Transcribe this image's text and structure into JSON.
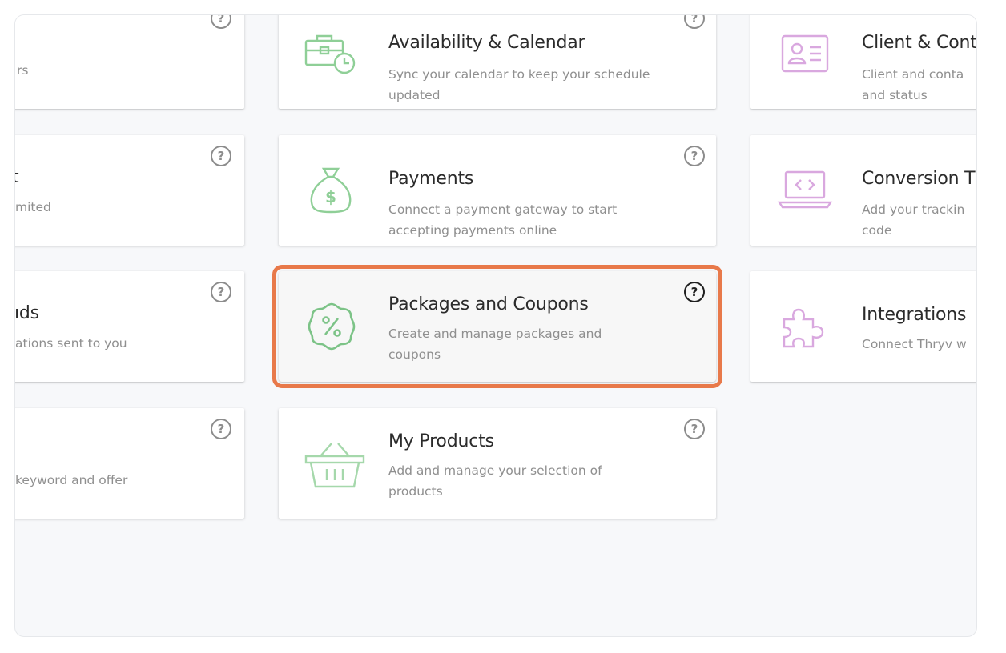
{
  "help_glyph": "?",
  "cards": {
    "left_row1": {
      "desc": "rs"
    },
    "left_row2": {
      "title": "t",
      "desc": "mited"
    },
    "left_row3": {
      "title": "ıds",
      "desc": "ations sent to you"
    },
    "left_row4": {
      "desc": "keyword and offer"
    },
    "availability": {
      "title": "Availability & Calendar",
      "desc": "Sync your calendar to keep your schedule updated",
      "icon": "briefcase-clock-icon"
    },
    "payments": {
      "title": "Payments",
      "desc": "Connect a payment gateway to start accepting payments online",
      "icon": "money-bag-icon"
    },
    "packages": {
      "title": "Packages and Coupons",
      "desc": "Create and manage packages and coupons",
      "icon": "percent-badge-icon"
    },
    "products": {
      "title": "My Products",
      "desc": "Add and manage your selection of products",
      "icon": "basket-icon"
    },
    "client": {
      "title": "Client & Cont",
      "desc": "Client and conta and status",
      "icon": "id-card-icon"
    },
    "conversion": {
      "title": "Conversion T",
      "desc": "Add your trackin code",
      "icon": "laptop-code-icon"
    },
    "integrations": {
      "title": "Integrations",
      "desc": "Connect Thryv w",
      "icon": "puzzle-icon"
    }
  },
  "colors": {
    "green_icon": "#8fcf97",
    "pink_icon": "#d9a8df",
    "highlight": "#e8794a"
  }
}
